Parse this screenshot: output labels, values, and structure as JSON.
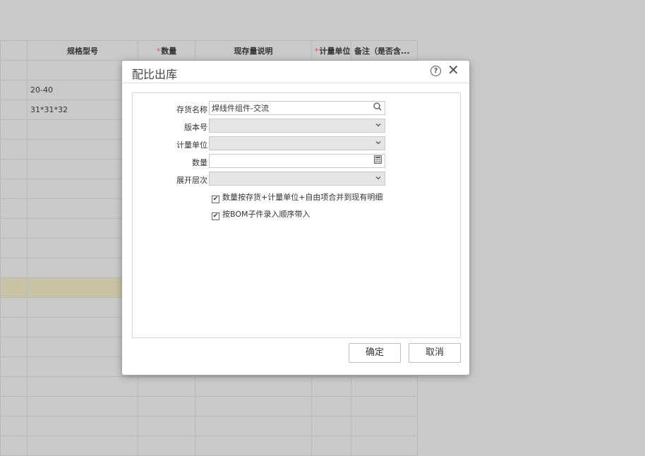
{
  "grid": {
    "headers": [
      {
        "label": "",
        "required": false
      },
      {
        "label": "规格型号",
        "required": false
      },
      {
        "label": "数量",
        "required": true
      },
      {
        "label": "现存量说明",
        "required": false
      },
      {
        "label": "计量单位",
        "required": true
      },
      {
        "label": "备注（是否含...",
        "required": false
      }
    ],
    "rows": [
      [
        "",
        "",
        "",
        "",
        "",
        ""
      ],
      [
        "",
        "20-40",
        "",
        "",
        "",
        ""
      ],
      [
        "",
        "31*31*32",
        "",
        "",
        "",
        ""
      ]
    ],
    "required_mark": "*"
  },
  "dialog": {
    "title": "配比出库",
    "help_icon": "?",
    "close_icon": "✕",
    "fields": {
      "inventory_name_label": "存货名称",
      "inventory_name_value": "焊线件组件-交流",
      "version_label": "版本号",
      "version_value": "",
      "unit_label": "计量单位",
      "unit_value": "",
      "quantity_label": "数量",
      "quantity_value": "",
      "level_label": "展开层次",
      "level_value": ""
    },
    "checkboxes": {
      "merge_label": "数量按存货+计量单位+自由项合并到现有明细",
      "merge_checked": true,
      "bom_order_label": "按BOM子件录入顺序带入",
      "bom_order_checked": true,
      "check_glyph": "✔"
    },
    "buttons": {
      "ok_label": "确定",
      "cancel_label": "取消"
    }
  }
}
